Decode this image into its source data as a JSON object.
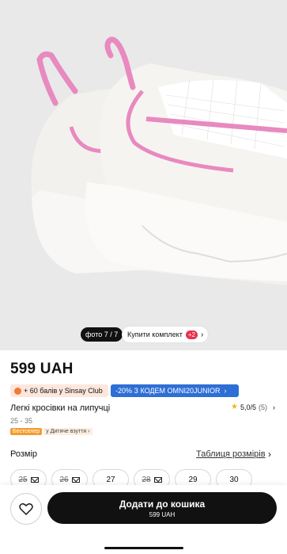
{
  "gallery": {
    "photo_counter": "фото 7 / 7",
    "kit_label": "Купити комплект",
    "kit_count": "+2"
  },
  "product": {
    "price": "599 UAH",
    "club_promo": "+ 60 балів у Sinsay Club",
    "code_promo": "-20% З КОДЕМ OMNI20JUNIOR",
    "title": "Легкі кросівки на липучці",
    "rating": "5,0/5",
    "review_count": "(5)",
    "age_range": "25 - 35",
    "badge_bestseller": "Бестселер",
    "badge_category": "у Дитяче взуття"
  },
  "sizes": {
    "label": "Розмір",
    "table_link": "Таблиця розмірів",
    "items": [
      {
        "value": "25",
        "available": false
      },
      {
        "value": "26",
        "available": false
      },
      {
        "value": "27",
        "available": true
      },
      {
        "value": "28",
        "available": false
      },
      {
        "value": "29",
        "available": true
      },
      {
        "value": "30",
        "available": true
      }
    ]
  },
  "cta": {
    "label": "Додати до кошика",
    "price": "599 UAH"
  },
  "colors": {
    "accent_pink": "#e87fb8",
    "promo_blue": "#2e6fd6",
    "bestseller_orange": "#f29d2e"
  }
}
